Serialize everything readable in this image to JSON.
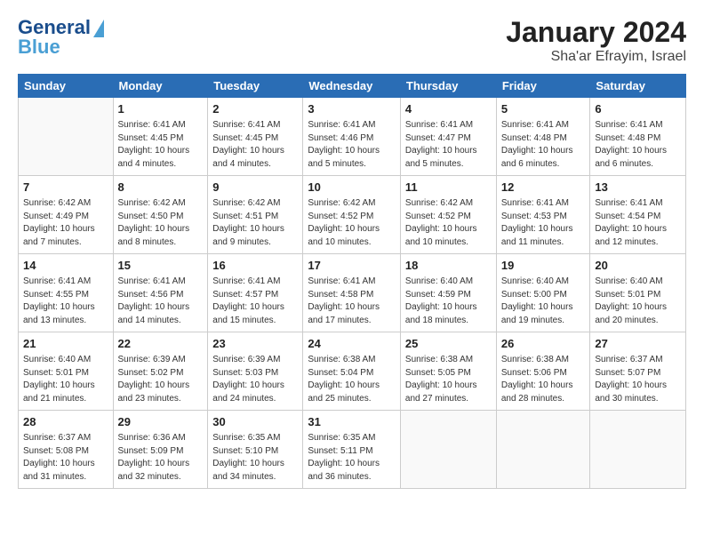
{
  "header": {
    "logo_line1": "General",
    "logo_line2": "Blue",
    "title": "January 2024",
    "subtitle": "Sha'ar Efrayim, Israel"
  },
  "columns": [
    "Sunday",
    "Monday",
    "Tuesday",
    "Wednesday",
    "Thursday",
    "Friday",
    "Saturday"
  ],
  "weeks": [
    [
      {
        "day": "",
        "info": ""
      },
      {
        "day": "1",
        "info": "Sunrise: 6:41 AM\nSunset: 4:45 PM\nDaylight: 10 hours\nand 4 minutes."
      },
      {
        "day": "2",
        "info": "Sunrise: 6:41 AM\nSunset: 4:45 PM\nDaylight: 10 hours\nand 4 minutes."
      },
      {
        "day": "3",
        "info": "Sunrise: 6:41 AM\nSunset: 4:46 PM\nDaylight: 10 hours\nand 5 minutes."
      },
      {
        "day": "4",
        "info": "Sunrise: 6:41 AM\nSunset: 4:47 PM\nDaylight: 10 hours\nand 5 minutes."
      },
      {
        "day": "5",
        "info": "Sunrise: 6:41 AM\nSunset: 4:48 PM\nDaylight: 10 hours\nand 6 minutes."
      },
      {
        "day": "6",
        "info": "Sunrise: 6:41 AM\nSunset: 4:48 PM\nDaylight: 10 hours\nand 6 minutes."
      }
    ],
    [
      {
        "day": "7",
        "info": "Sunrise: 6:42 AM\nSunset: 4:49 PM\nDaylight: 10 hours\nand 7 minutes."
      },
      {
        "day": "8",
        "info": "Sunrise: 6:42 AM\nSunset: 4:50 PM\nDaylight: 10 hours\nand 8 minutes."
      },
      {
        "day": "9",
        "info": "Sunrise: 6:42 AM\nSunset: 4:51 PM\nDaylight: 10 hours\nand 9 minutes."
      },
      {
        "day": "10",
        "info": "Sunrise: 6:42 AM\nSunset: 4:52 PM\nDaylight: 10 hours\nand 10 minutes."
      },
      {
        "day": "11",
        "info": "Sunrise: 6:42 AM\nSunset: 4:52 PM\nDaylight: 10 hours\nand 10 minutes."
      },
      {
        "day": "12",
        "info": "Sunrise: 6:41 AM\nSunset: 4:53 PM\nDaylight: 10 hours\nand 11 minutes."
      },
      {
        "day": "13",
        "info": "Sunrise: 6:41 AM\nSunset: 4:54 PM\nDaylight: 10 hours\nand 12 minutes."
      }
    ],
    [
      {
        "day": "14",
        "info": "Sunrise: 6:41 AM\nSunset: 4:55 PM\nDaylight: 10 hours\nand 13 minutes."
      },
      {
        "day": "15",
        "info": "Sunrise: 6:41 AM\nSunset: 4:56 PM\nDaylight: 10 hours\nand 14 minutes."
      },
      {
        "day": "16",
        "info": "Sunrise: 6:41 AM\nSunset: 4:57 PM\nDaylight: 10 hours\nand 15 minutes."
      },
      {
        "day": "17",
        "info": "Sunrise: 6:41 AM\nSunset: 4:58 PM\nDaylight: 10 hours\nand 17 minutes."
      },
      {
        "day": "18",
        "info": "Sunrise: 6:40 AM\nSunset: 4:59 PM\nDaylight: 10 hours\nand 18 minutes."
      },
      {
        "day": "19",
        "info": "Sunrise: 6:40 AM\nSunset: 5:00 PM\nDaylight: 10 hours\nand 19 minutes."
      },
      {
        "day": "20",
        "info": "Sunrise: 6:40 AM\nSunset: 5:01 PM\nDaylight: 10 hours\nand 20 minutes."
      }
    ],
    [
      {
        "day": "21",
        "info": "Sunrise: 6:40 AM\nSunset: 5:01 PM\nDaylight: 10 hours\nand 21 minutes."
      },
      {
        "day": "22",
        "info": "Sunrise: 6:39 AM\nSunset: 5:02 PM\nDaylight: 10 hours\nand 23 minutes."
      },
      {
        "day": "23",
        "info": "Sunrise: 6:39 AM\nSunset: 5:03 PM\nDaylight: 10 hours\nand 24 minutes."
      },
      {
        "day": "24",
        "info": "Sunrise: 6:38 AM\nSunset: 5:04 PM\nDaylight: 10 hours\nand 25 minutes."
      },
      {
        "day": "25",
        "info": "Sunrise: 6:38 AM\nSunset: 5:05 PM\nDaylight: 10 hours\nand 27 minutes."
      },
      {
        "day": "26",
        "info": "Sunrise: 6:38 AM\nSunset: 5:06 PM\nDaylight: 10 hours\nand 28 minutes."
      },
      {
        "day": "27",
        "info": "Sunrise: 6:37 AM\nSunset: 5:07 PM\nDaylight: 10 hours\nand 30 minutes."
      }
    ],
    [
      {
        "day": "28",
        "info": "Sunrise: 6:37 AM\nSunset: 5:08 PM\nDaylight: 10 hours\nand 31 minutes."
      },
      {
        "day": "29",
        "info": "Sunrise: 6:36 AM\nSunset: 5:09 PM\nDaylight: 10 hours\nand 32 minutes."
      },
      {
        "day": "30",
        "info": "Sunrise: 6:35 AM\nSunset: 5:10 PM\nDaylight: 10 hours\nand 34 minutes."
      },
      {
        "day": "31",
        "info": "Sunrise: 6:35 AM\nSunset: 5:11 PM\nDaylight: 10 hours\nand 36 minutes."
      },
      {
        "day": "",
        "info": ""
      },
      {
        "day": "",
        "info": ""
      },
      {
        "day": "",
        "info": ""
      }
    ]
  ]
}
